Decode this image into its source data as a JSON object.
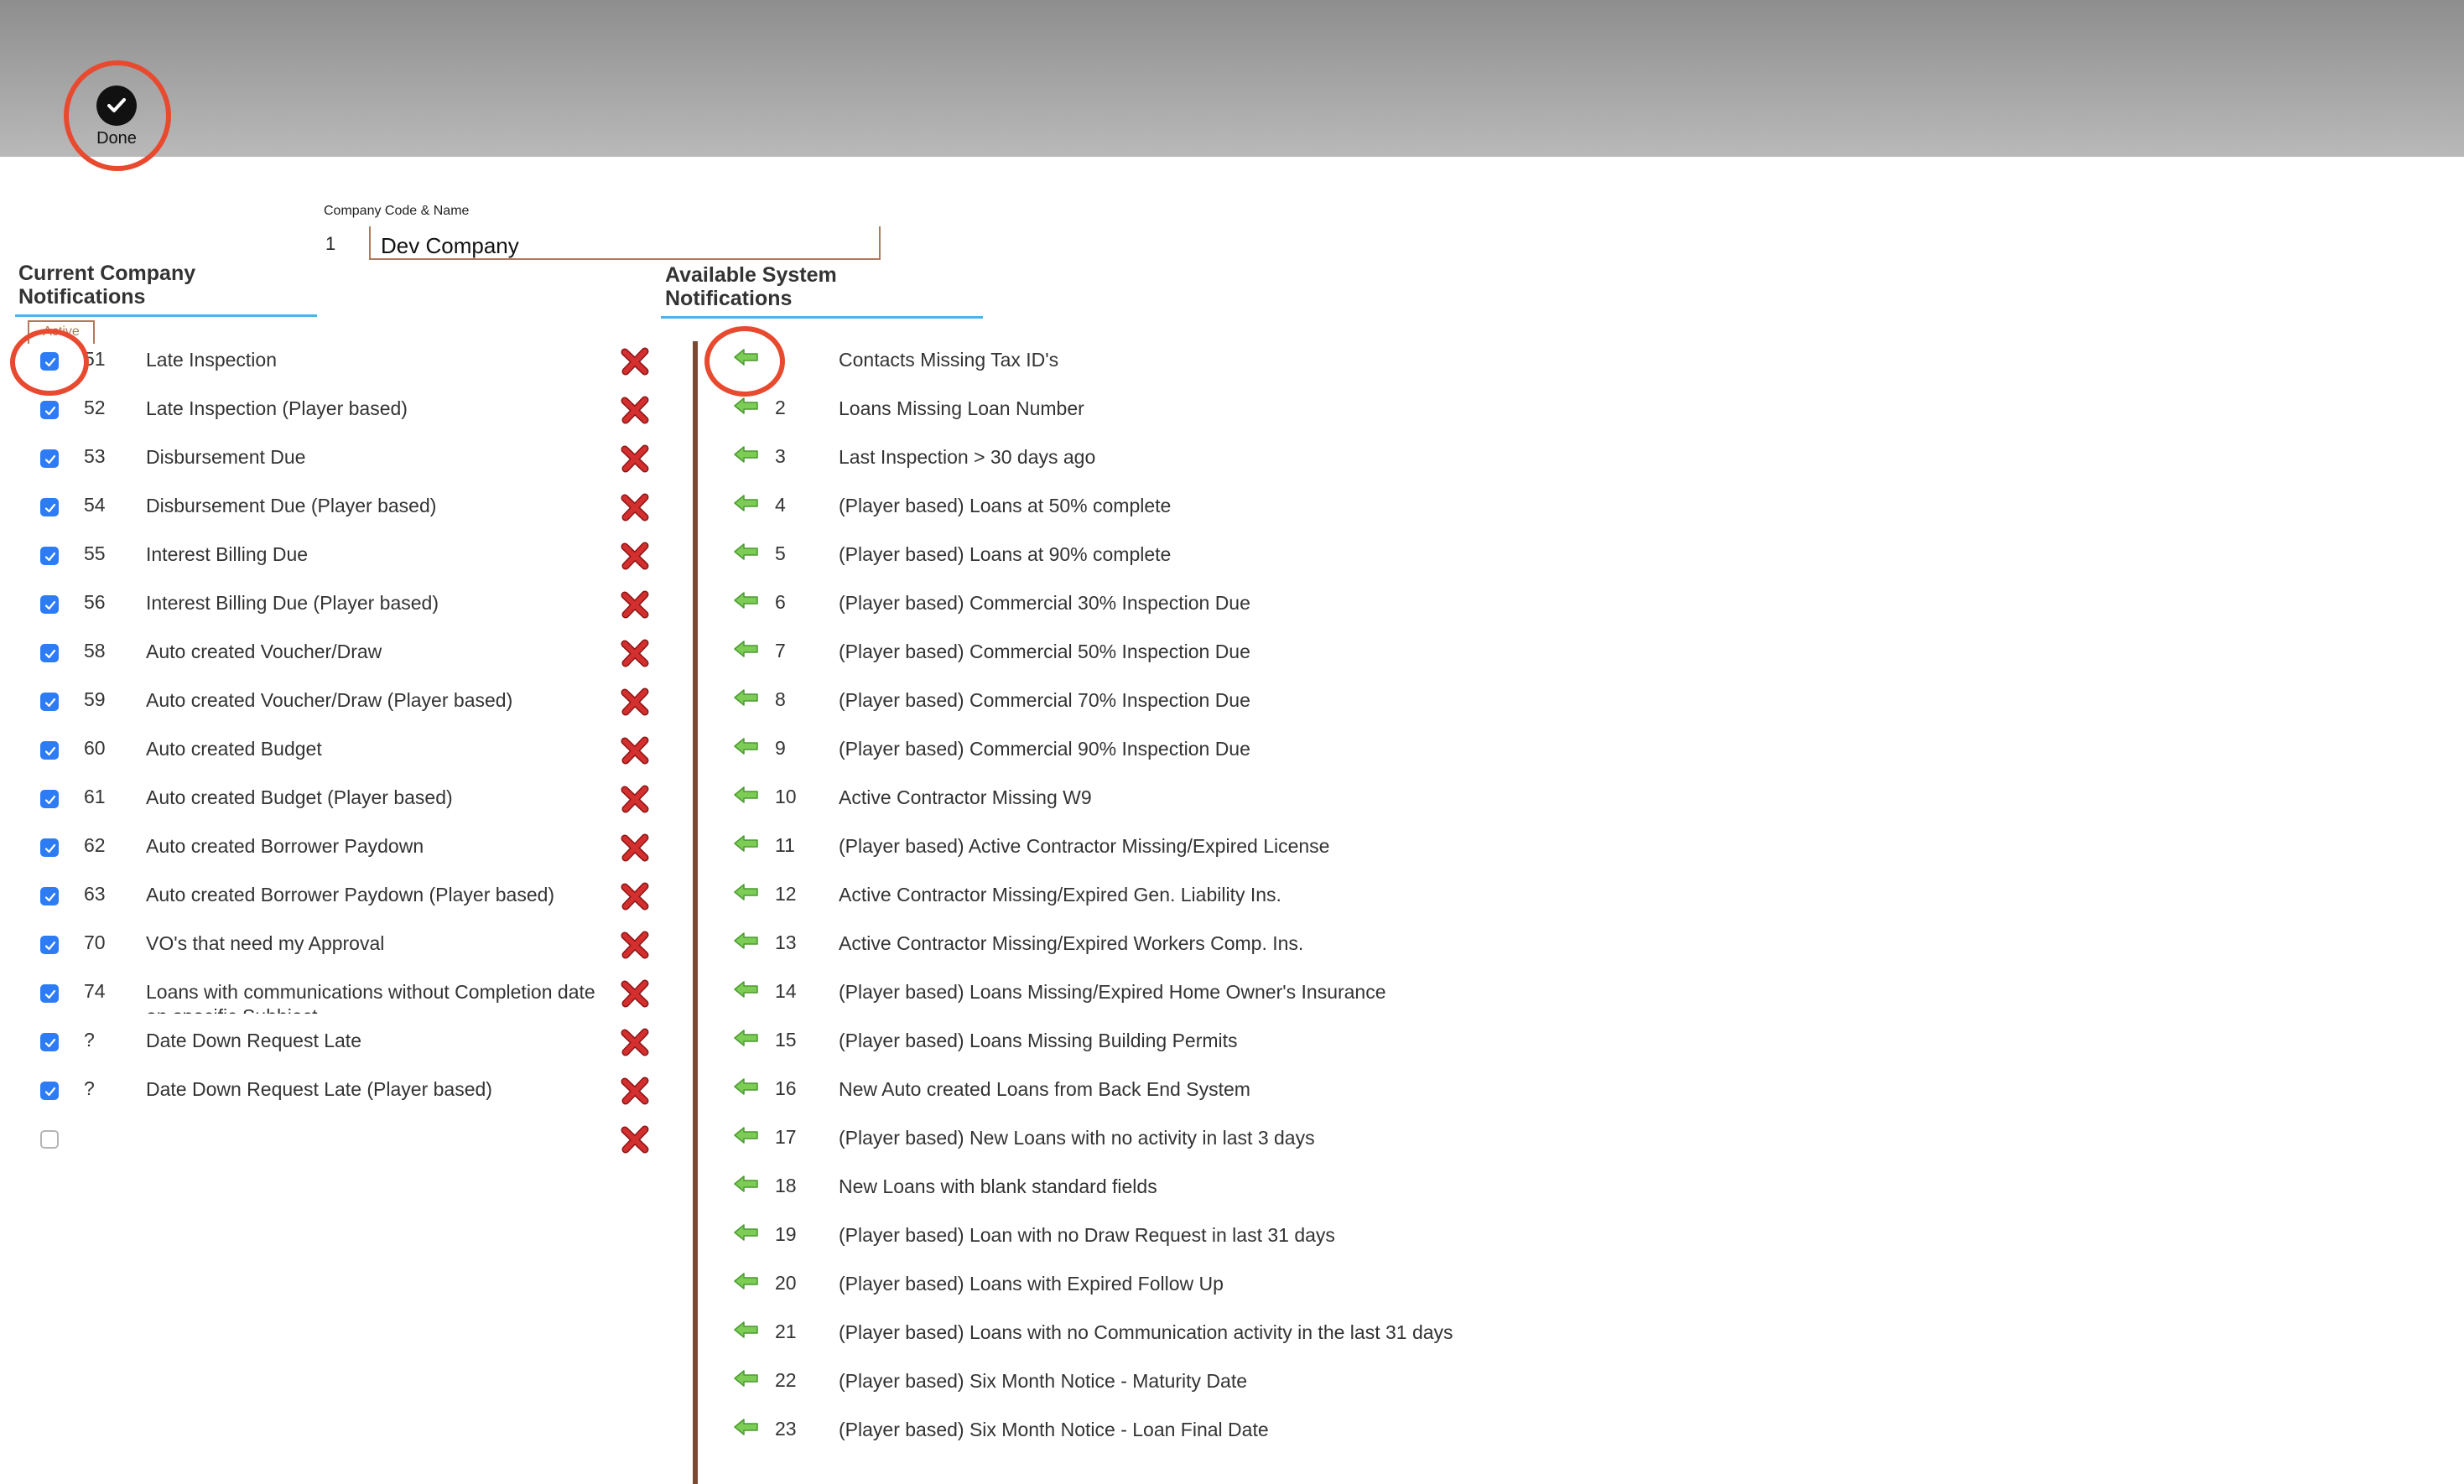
{
  "toolbar": {
    "done_label": "Done"
  },
  "company": {
    "label": "Company Code & Name",
    "code": "1",
    "name": "Dev Company"
  },
  "current": {
    "title_line1": "Current Company",
    "title_line2": "Notifications",
    "tab_label": "Active",
    "items": [
      {
        "num": "51",
        "label": "Late Inspection",
        "checked": true
      },
      {
        "num": "52",
        "label": "Late Inspection (Player based)",
        "checked": true
      },
      {
        "num": "53",
        "label": "Disbursement Due",
        "checked": true
      },
      {
        "num": "54",
        "label": "Disbursement Due (Player based)",
        "checked": true
      },
      {
        "num": "55",
        "label": "Interest Billing Due",
        "checked": true
      },
      {
        "num": "56",
        "label": "Interest Billing Due (Player based)",
        "checked": true
      },
      {
        "num": "58",
        "label": "Auto created Voucher/Draw",
        "checked": true
      },
      {
        "num": "59",
        "label": "Auto created Voucher/Draw (Player based)",
        "checked": true
      },
      {
        "num": "60",
        "label": "Auto created Budget",
        "checked": true
      },
      {
        "num": "61",
        "label": "Auto created Budget (Player based)",
        "checked": true
      },
      {
        "num": "62",
        "label": "Auto created Borrower Paydown",
        "checked": true
      },
      {
        "num": "63",
        "label": "Auto created Borrower Paydown (Player based)",
        "checked": true
      },
      {
        "num": "70",
        "label": "VO's that need my Approval",
        "checked": true
      },
      {
        "num": "74",
        "label": "Loans with communications without Completion date on specific Subhject",
        "checked": true
      },
      {
        "num": "?",
        "label": "Date Down Request Late",
        "checked": true
      },
      {
        "num": "?",
        "label": "Date Down Request Late (Player based)",
        "checked": true
      },
      {
        "num": "",
        "label": "",
        "checked": false
      }
    ]
  },
  "available": {
    "title_line1": "Available System",
    "title_line2": "Notifications",
    "items": [
      {
        "num": "",
        "label": "Contacts Missing Tax ID's"
      },
      {
        "num": "2",
        "label": "Loans Missing Loan Number"
      },
      {
        "num": "3",
        "label": "Last Inspection > 30 days ago"
      },
      {
        "num": "4",
        "label": "(Player based) Loans at 50% complete"
      },
      {
        "num": "5",
        "label": "(Player based) Loans at 90% complete"
      },
      {
        "num": "6",
        "label": "(Player based) Commercial 30% Inspection Due"
      },
      {
        "num": "7",
        "label": "(Player based) Commercial 50% Inspection Due"
      },
      {
        "num": "8",
        "label": "(Player based) Commercial 70% Inspection Due"
      },
      {
        "num": "9",
        "label": "(Player based) Commercial 90% Inspection Due"
      },
      {
        "num": "10",
        "label": "Active Contractor Missing W9"
      },
      {
        "num": "11",
        "label": "(Player based) Active Contractor Missing/Expired License"
      },
      {
        "num": "12",
        "label": "Active Contractor Missing/Expired Gen. Liability Ins."
      },
      {
        "num": "13",
        "label": "Active Contractor Missing/Expired Workers Comp. Ins."
      },
      {
        "num": "14",
        "label": "(Player based) Loans Missing/Expired Home Owner's Insurance"
      },
      {
        "num": "15",
        "label": "(Player based) Loans Missing Building Permits"
      },
      {
        "num": "16",
        "label": "New Auto created Loans from Back End System"
      },
      {
        "num": "17",
        "label": "(Player based) New Loans with no activity in last 3 days"
      },
      {
        "num": "18",
        "label": "New Loans with blank standard fields"
      },
      {
        "num": "19",
        "label": "(Player based) Loan with no Draw Request in last 31 days"
      },
      {
        "num": "20",
        "label": "(Player based) Loans with Expired Follow Up"
      },
      {
        "num": "21",
        "label": "(Player based) Loans with no Communication activity in the last 31 days"
      },
      {
        "num": "22",
        "label": "(Player based) Six Month Notice - Maturity Date"
      },
      {
        "num": "23",
        "label": "(Player based) Six Month Notice - Loan Final Date"
      }
    ]
  },
  "colors": {
    "accent_blue": "#4fb3e8",
    "checkbox_blue": "#2d7cf6",
    "remove_red": "#c62828",
    "add_green": "#6cc04a",
    "annotation_red": "#e84a2f",
    "divider_brown": "#7a4a32"
  },
  "icons": {
    "done": "check-circle-icon",
    "remove": "red-x-icon",
    "add": "green-arrow-left-icon",
    "checkbox": "checkbox-icon"
  }
}
